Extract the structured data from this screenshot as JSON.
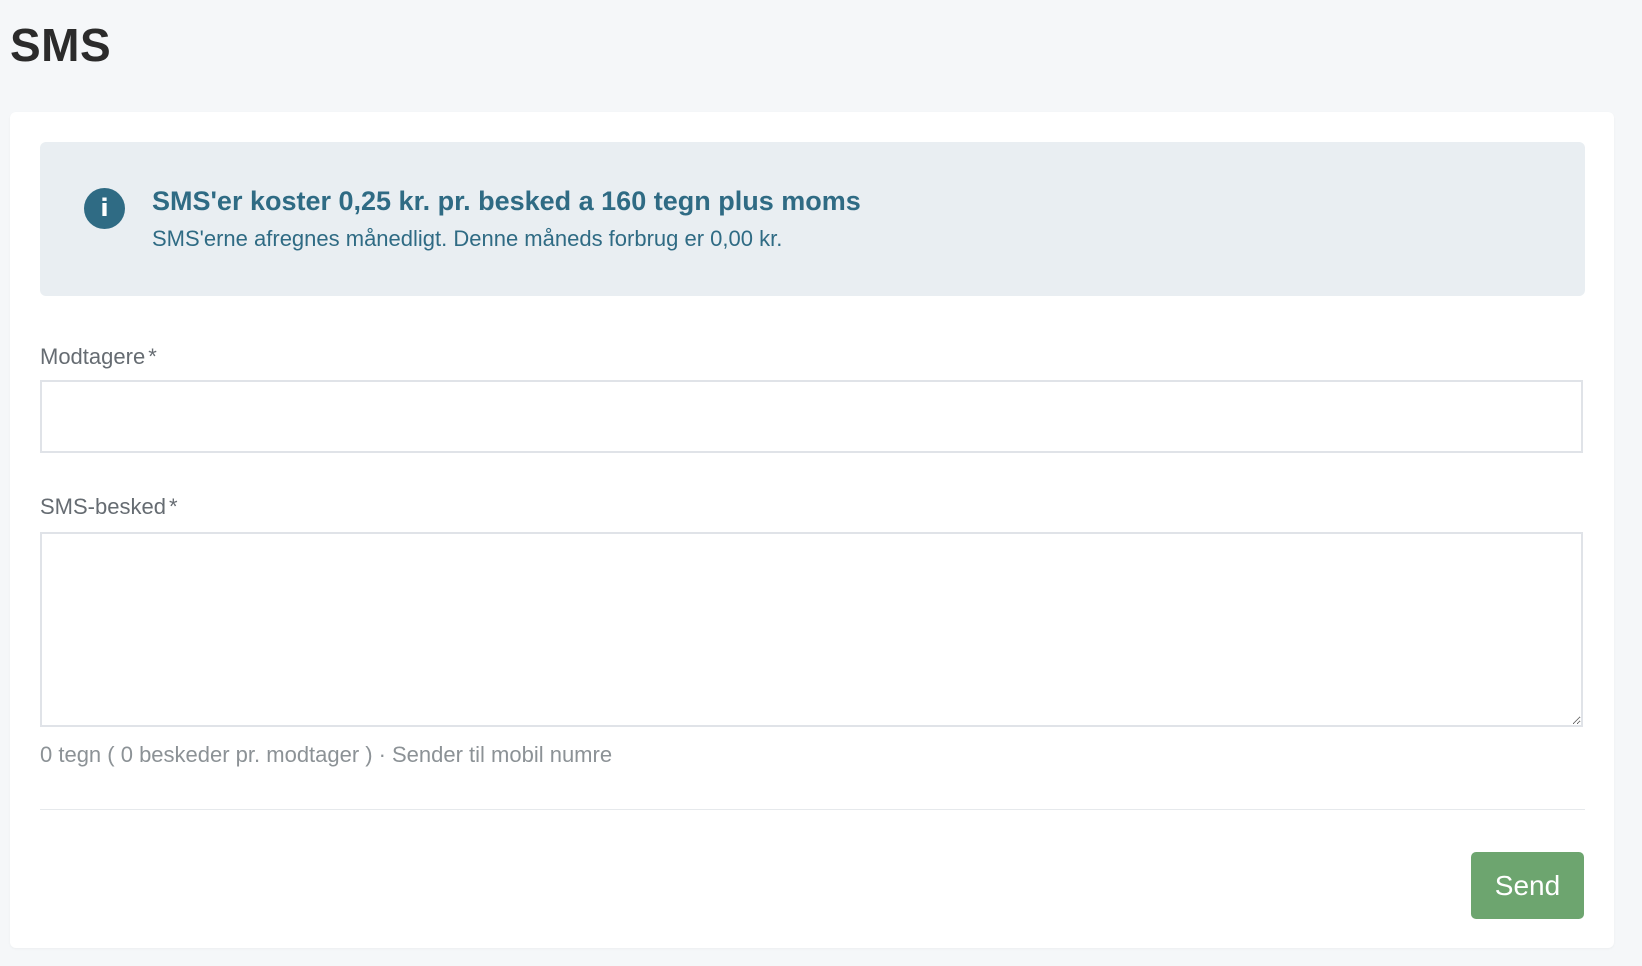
{
  "page": {
    "title": "SMS"
  },
  "info": {
    "icon": "info-icon",
    "icon_glyph": "i",
    "title": "SMS'er koster 0,25 kr. pr. besked a 160 tegn plus moms",
    "text": "SMS'erne afregnes månedligt. Denne måneds forbrug er 0,00 kr."
  },
  "form": {
    "recipients": {
      "label": "Modtagere",
      "required_mark": "*",
      "value": ""
    },
    "message": {
      "label": "SMS-besked",
      "required_mark": "*",
      "value": ""
    },
    "counter": {
      "chars": "0 tegn ( 0 beskeder pr. modtager )",
      "separator": "·",
      "note": "Sender til mobil numre"
    },
    "send_label": "Send"
  },
  "colors": {
    "info_accent": "#2f6b84",
    "info_background": "#e9eef2",
    "send_button": "#6da56f",
    "page_background": "#f5f7f9"
  }
}
